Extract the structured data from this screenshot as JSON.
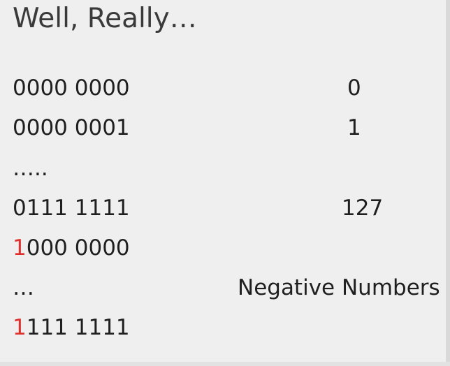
{
  "slide": {
    "title": "Well, Really…",
    "rows": [
      {
        "bits": "0000 0000",
        "value": "0"
      },
      {
        "bits": "0000 0001",
        "value": "1"
      },
      {
        "bits": "….."
      },
      {
        "bits": "0111 1111",
        "value": "127"
      },
      {
        "sign": "1",
        "bits_rest": "000 0000"
      },
      {
        "bits": "…",
        "value": "Negative Numbers"
      },
      {
        "sign": "1",
        "bits_rest": "111 1111"
      }
    ]
  },
  "colors": {
    "background": "#efefef",
    "text": "#1f1f1f",
    "sign_bit": "#e0302e"
  }
}
